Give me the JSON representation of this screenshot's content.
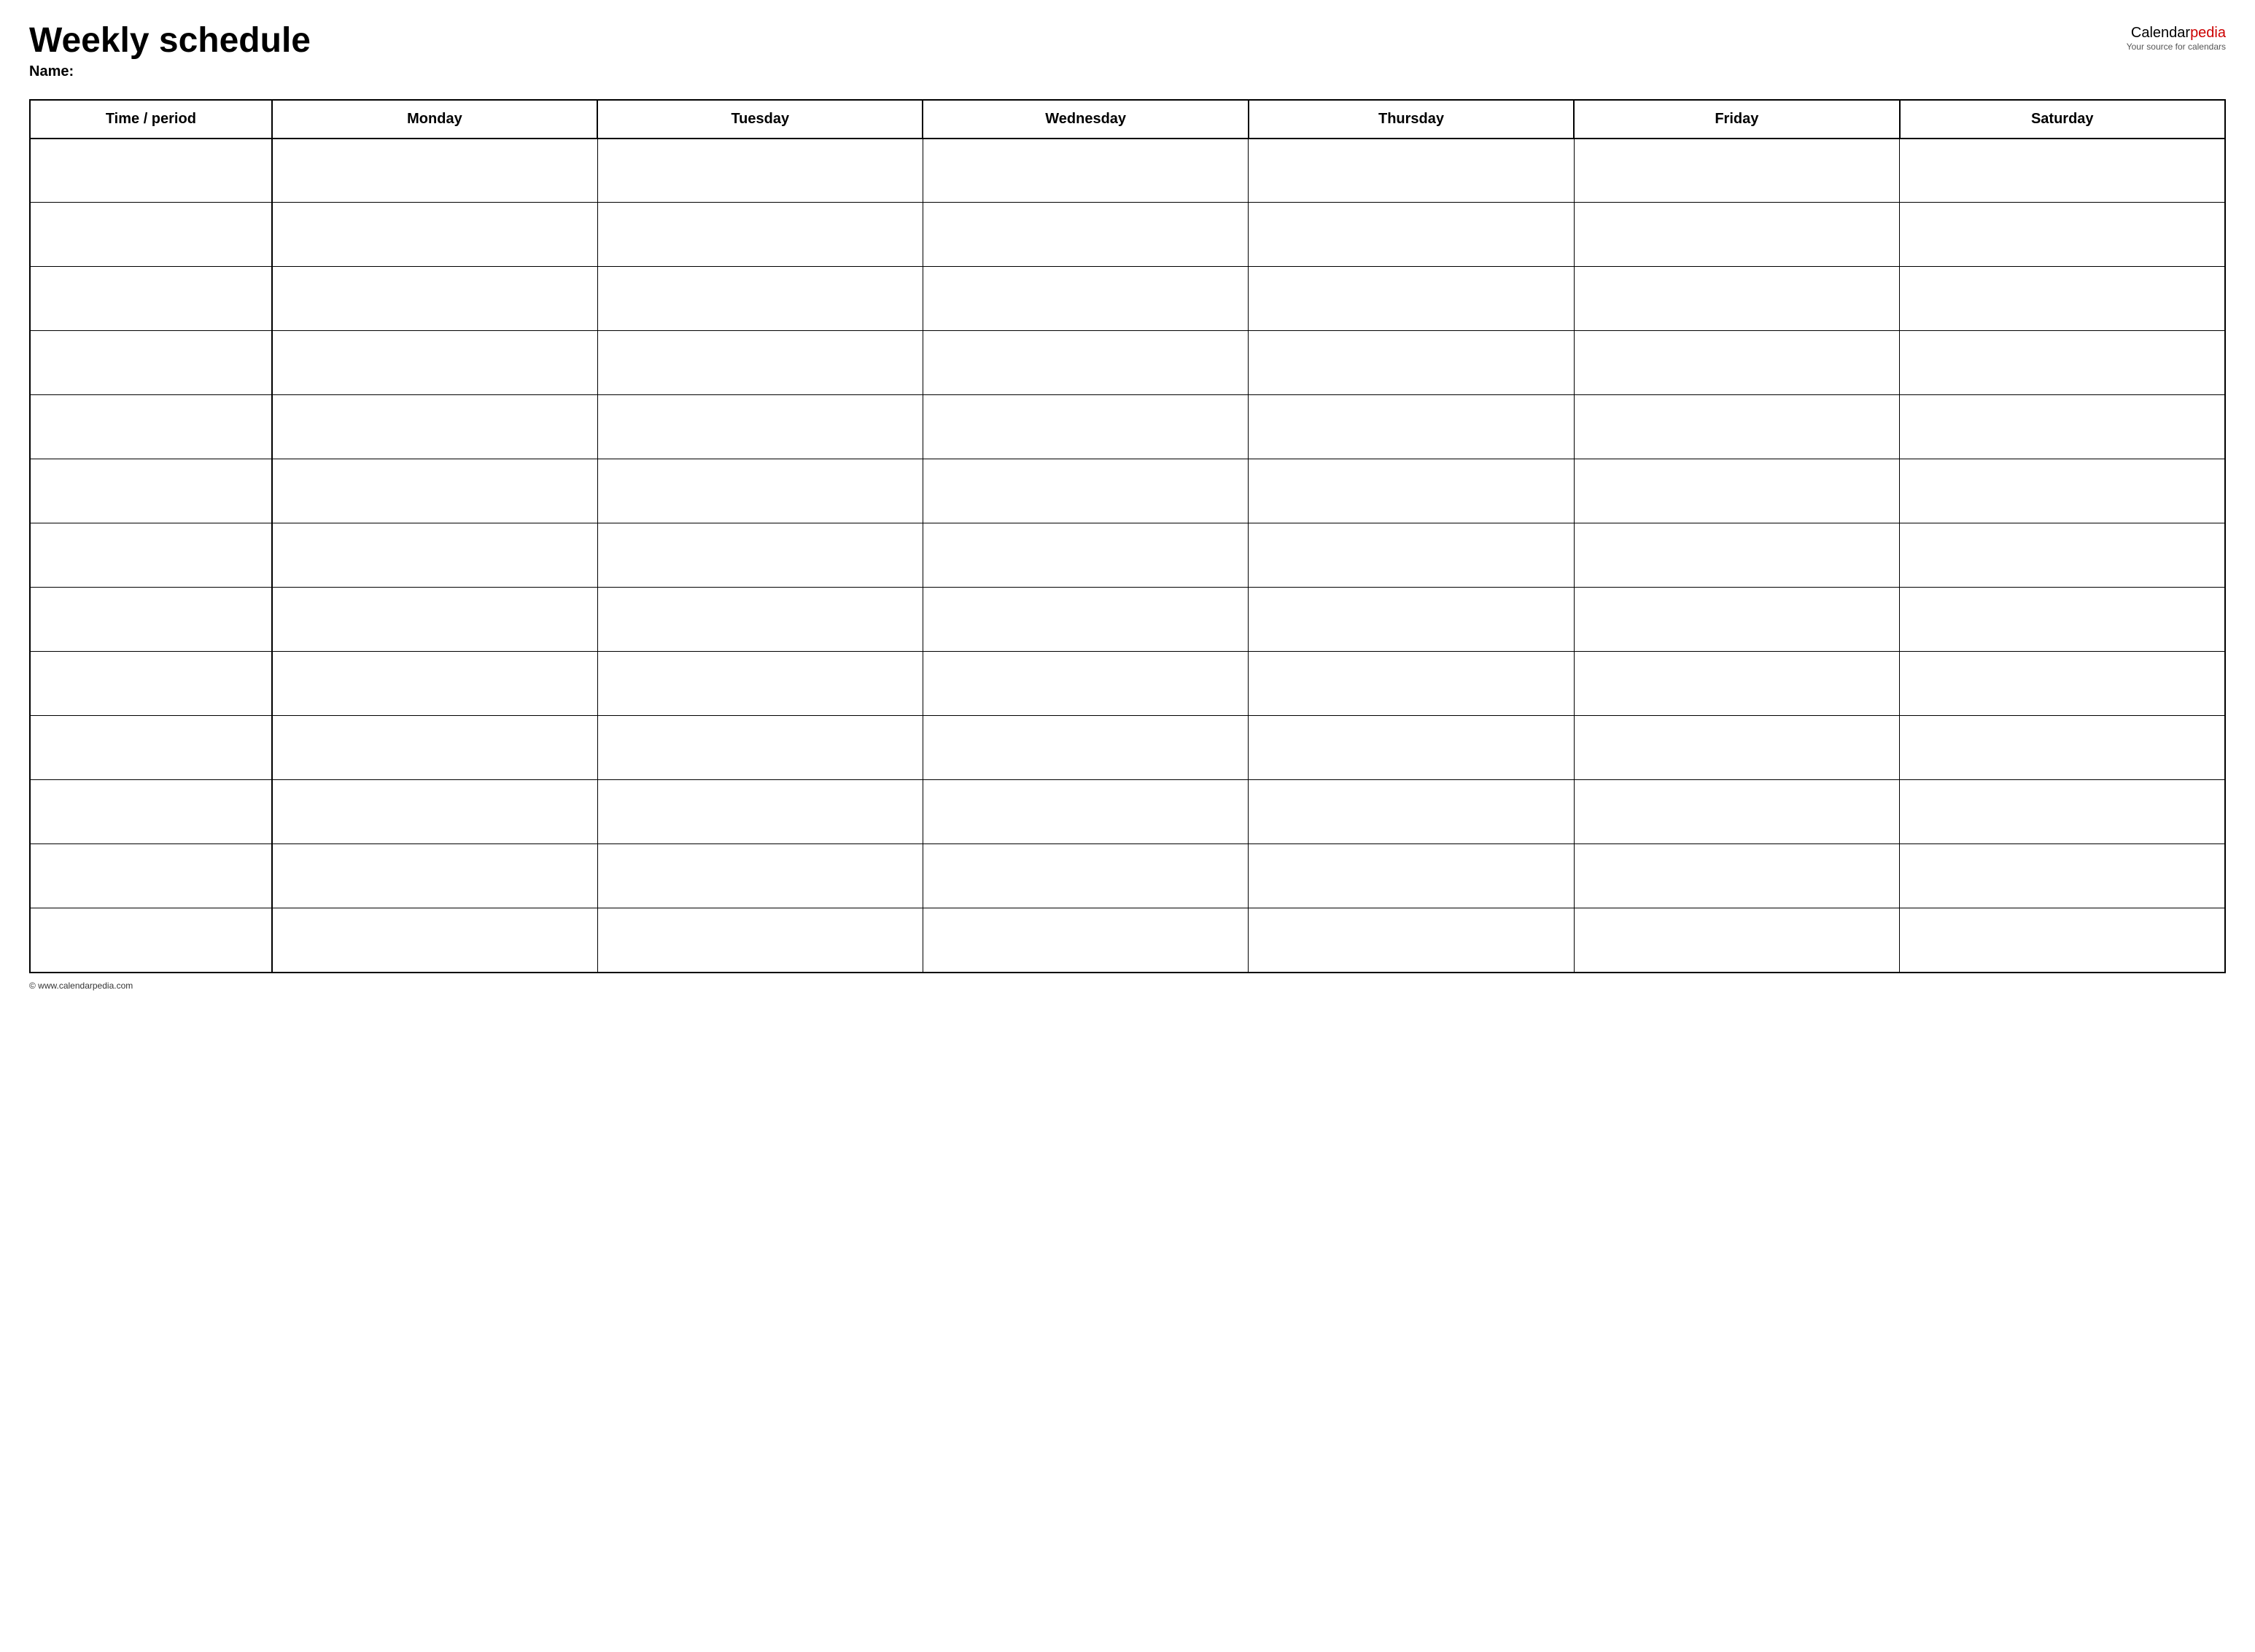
{
  "header": {
    "title": "Weekly schedule",
    "logo_calendar": "Calendar",
    "logo_pedia": "pedia",
    "logo_subtitle": "Your source for calendars",
    "name_label": "Name:"
  },
  "table": {
    "columns": [
      {
        "id": "time",
        "label": "Time / period"
      },
      {
        "id": "monday",
        "label": "Monday"
      },
      {
        "id": "tuesday",
        "label": "Tuesday"
      },
      {
        "id": "wednesday",
        "label": "Wednesday"
      },
      {
        "id": "thursday",
        "label": "Thursday"
      },
      {
        "id": "friday",
        "label": "Friday"
      },
      {
        "id": "saturday",
        "label": "Saturday"
      }
    ],
    "row_count": 13
  },
  "footer": {
    "copyright": "© www.calendarpedia.com"
  }
}
